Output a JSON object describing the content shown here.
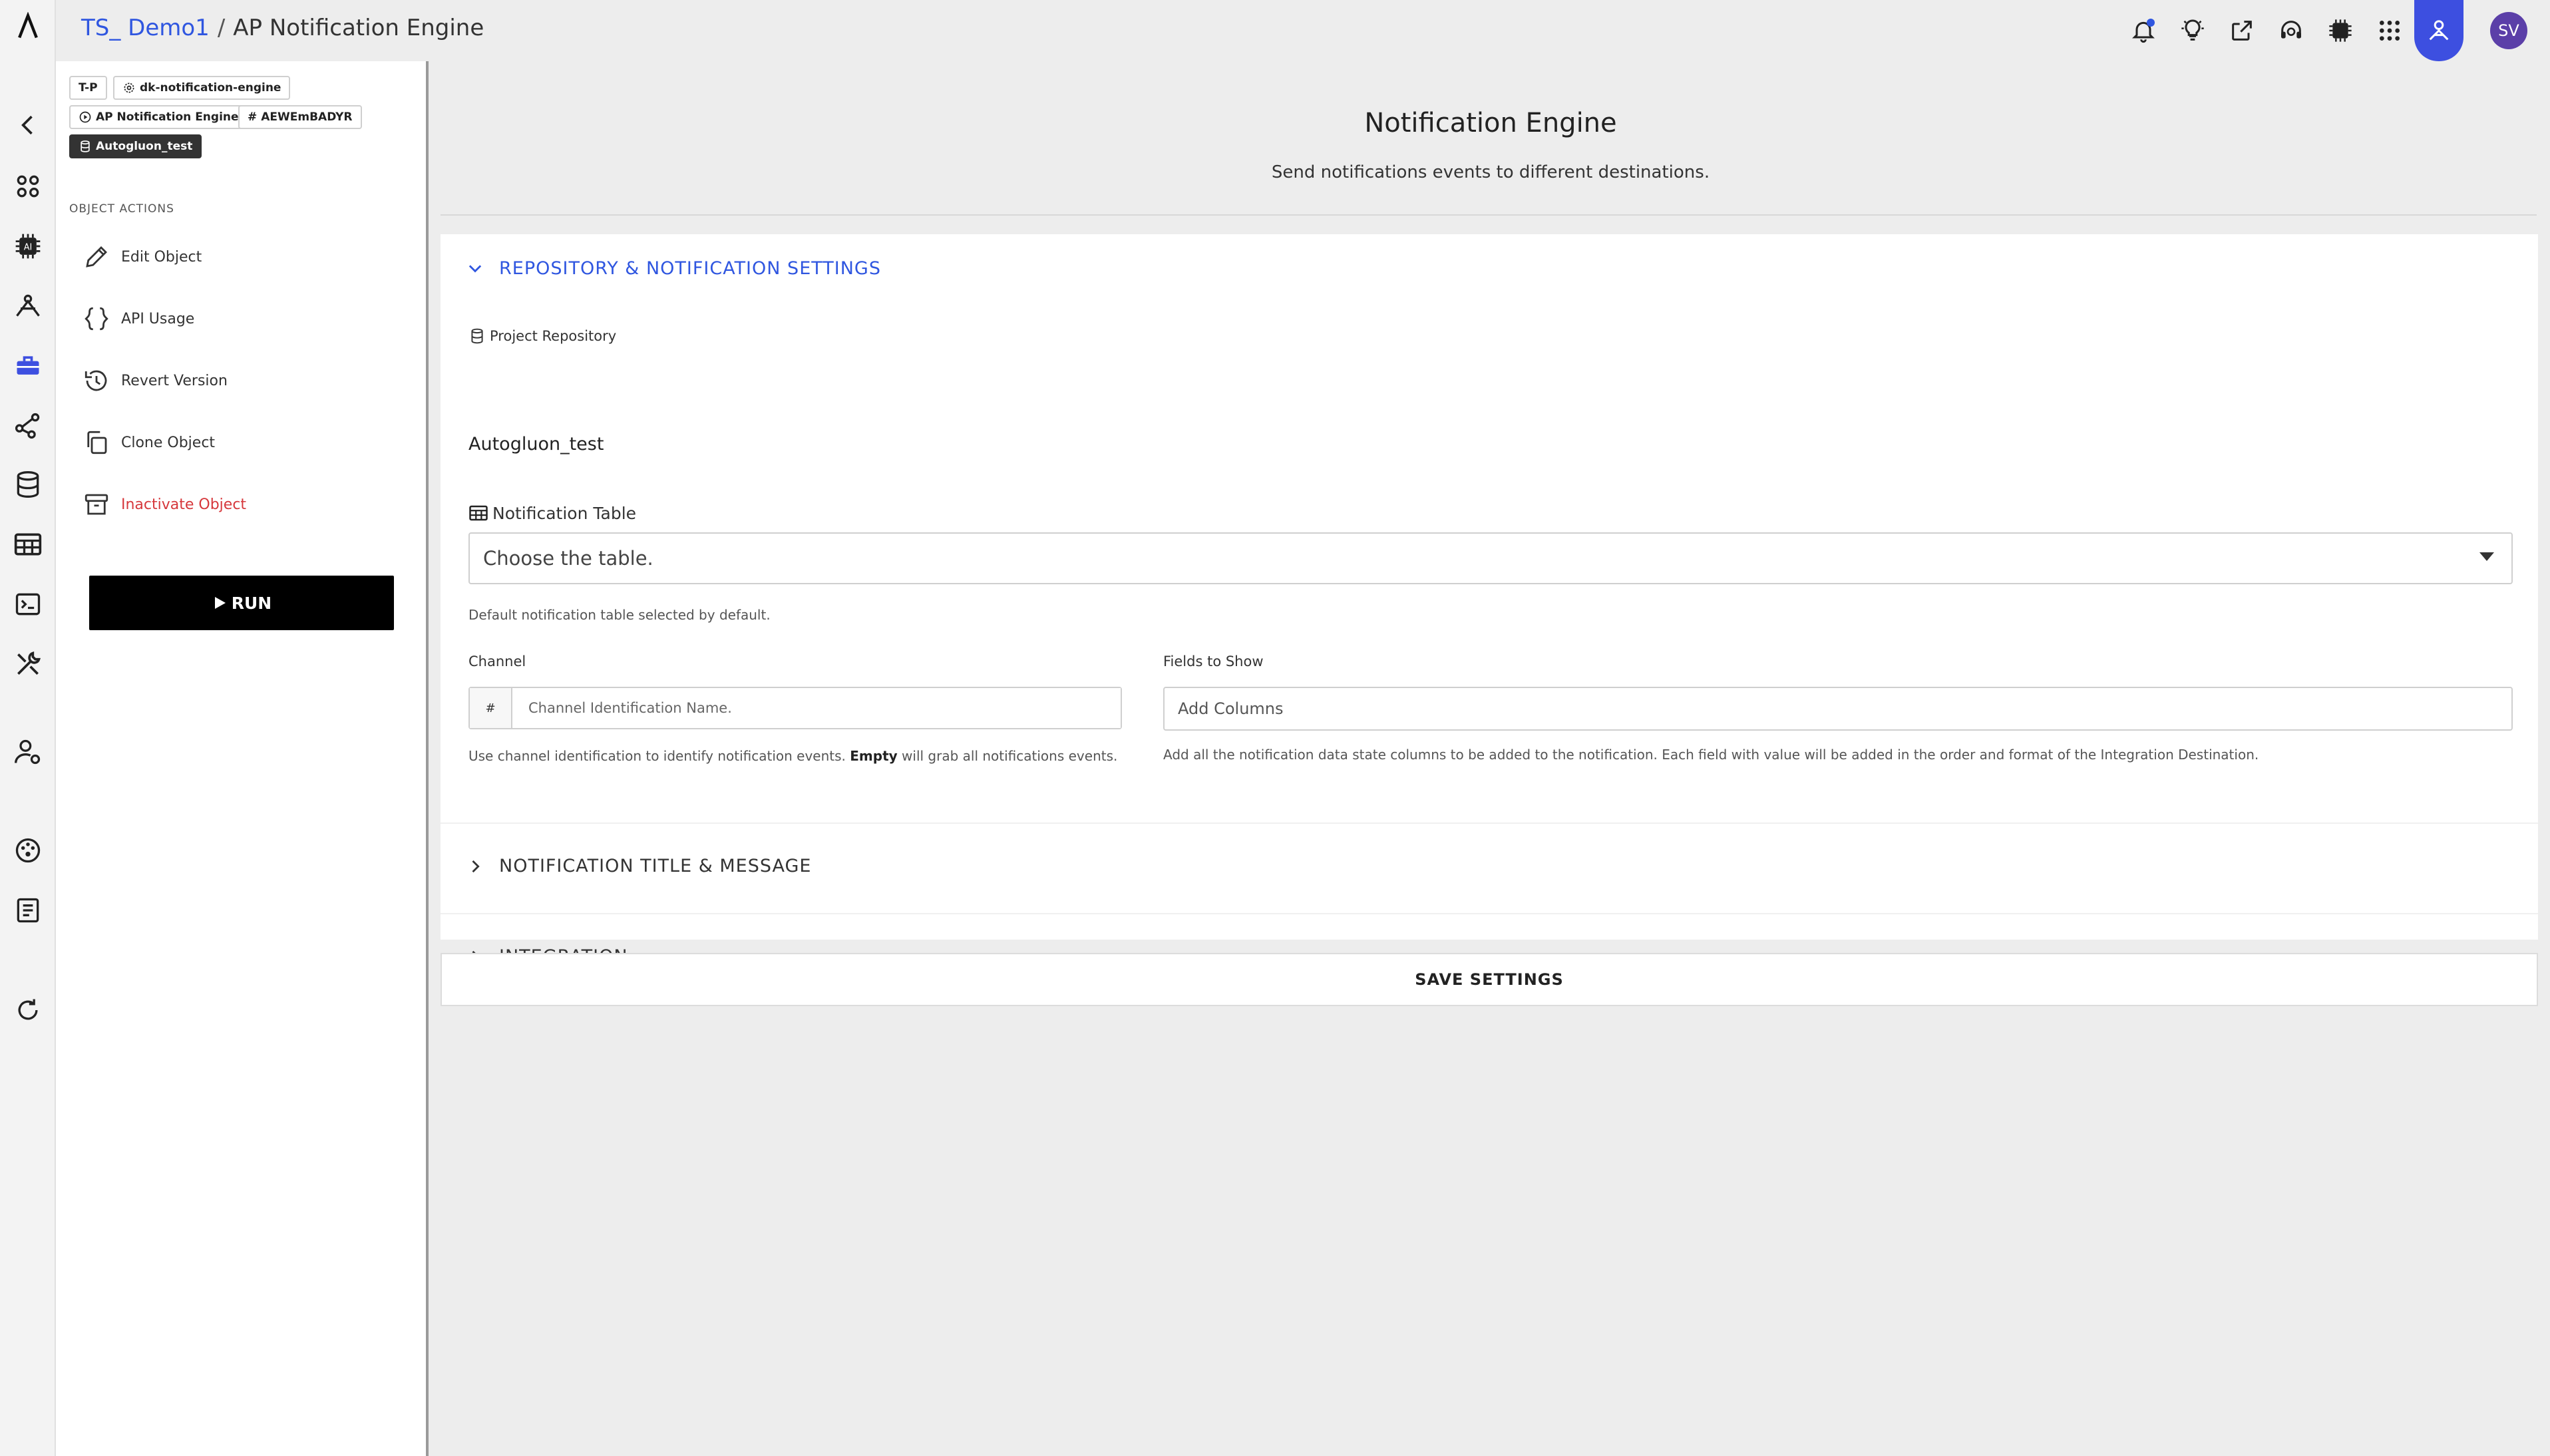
{
  "breadcrumb": {
    "project": "TS_ Demo1",
    "separator": "/",
    "current": "AP Notification Engine"
  },
  "header": {
    "icons": [
      "bell-icon",
      "lightbulb-icon",
      "share-icon",
      "support-icon",
      "chip-icon",
      "apps-grid-icon",
      "user-icon"
    ],
    "avatar_initials": "SV"
  },
  "rail": {
    "icons": [
      "logo-icon",
      "back-icon",
      "dashboard-icon",
      "ai-icon",
      "model-icon",
      "toolbox-icon",
      "graph-icon",
      "database-icon",
      "table-icon",
      "terminal-icon",
      "tools-icon",
      "user-settings-icon",
      "palette-icon",
      "docs-icon",
      "refresh-icon"
    ]
  },
  "panel": {
    "tags": {
      "tp": "T-P",
      "engine_id": "dk-notification-engine",
      "engine_name": "AP Notification Engine",
      "hash_id": "AEWEmBADYR",
      "repository": "Autogluon_test"
    },
    "section_label": "OBJECT ACTIONS",
    "actions": {
      "edit": "Edit Object",
      "api": "API Usage",
      "revert": "Revert Version",
      "clone": "Clone Object",
      "inactivate": "Inactivate Object"
    },
    "run_label": "RUN"
  },
  "main": {
    "title": "Notification Engine",
    "subtitle": "Send notifications events to different destinations.",
    "sections": {
      "repo": "REPOSITORY & NOTIFICATION SETTINGS",
      "title_msg": "NOTIFICATION TITLE & MESSAGE",
      "integration": "INTEGRATION"
    },
    "project_repository": {
      "label": "Project Repository",
      "value": "Autogluon_test"
    },
    "notification_table": {
      "label": "Notification Table",
      "placeholder": "Choose the table.",
      "hint": "Default notification table selected by default."
    },
    "channel": {
      "label": "Channel",
      "prefix": "#",
      "placeholder": "Channel Identification Name.",
      "hint_before": "Use channel identification to identify notification events.",
      "hint_bold": "Empty",
      "hint_after": "will grab all notifications events."
    },
    "fields_to_show": {
      "label": "Fields to Show",
      "placeholder": "Add Columns",
      "hint": "Add all the notification data state columns to be added to the notification. Each field with value will be added in the order and format of the Integration Destination."
    },
    "save_label": "SAVE SETTINGS"
  },
  "colors": {
    "accent": "#2f56e0",
    "danger": "#d6373b",
    "avatar": "#5b3fa8"
  }
}
